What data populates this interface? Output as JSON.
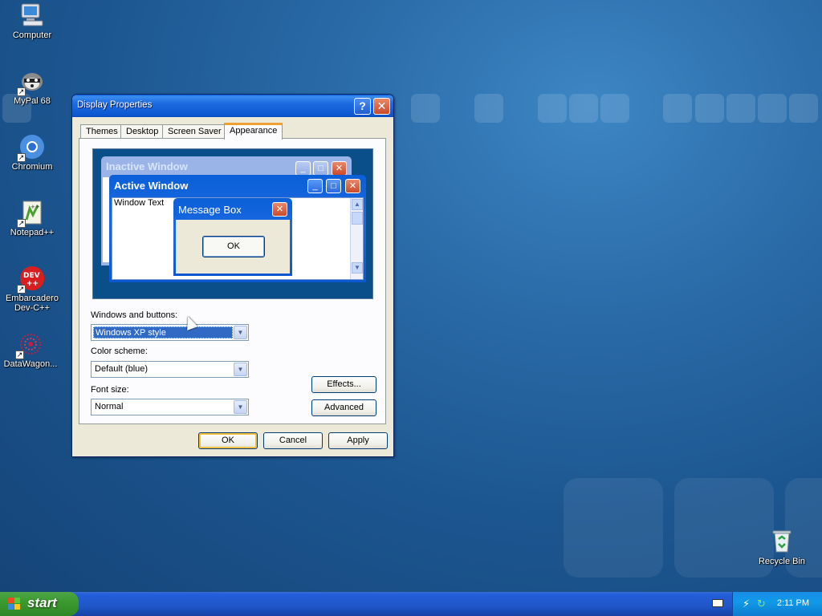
{
  "desktop": {
    "icons": [
      {
        "label": "Computer"
      },
      {
        "label": "MyPal 68"
      },
      {
        "label": "Chromium"
      },
      {
        "label": "Notepad++"
      },
      {
        "label": "Embarcadero Dev-C++"
      },
      {
        "label": "DataWagon..."
      },
      {
        "label": "Recycle Bin"
      }
    ]
  },
  "dialog": {
    "title": "Display Properties",
    "help_btn": "?",
    "close_btn": "✕",
    "tabs": [
      "Themes",
      "Desktop",
      "Screen Saver",
      "Appearance"
    ],
    "active_tab": "Appearance",
    "preview": {
      "inactive_title": "Inactive Window",
      "active_title": "Active Window",
      "window_text": "Window Text",
      "msgbox_title": "Message Box",
      "msgbox_ok": "OK"
    },
    "windows_buttons_label": "Windows and buttons:",
    "windows_buttons_value": "Windows XP style",
    "color_scheme_label": "Color scheme:",
    "color_scheme_value": "Default (blue)",
    "font_size_label": "Font size:",
    "font_size_value": "Normal",
    "effects_btn": "Effects...",
    "advanced_btn": "Advanced",
    "ok_btn": "OK",
    "cancel_btn": "Cancel",
    "apply_btn": "Apply"
  },
  "taskbar": {
    "start_label": "start",
    "clock": "2:11 PM"
  },
  "colors": {
    "desktop_bg": "#2a6ba8",
    "titlebar": "#0a5fd8",
    "dialog_face": "#ece9d8",
    "start_green": "#3c9a30",
    "taskbar_blue": "#245edb"
  }
}
